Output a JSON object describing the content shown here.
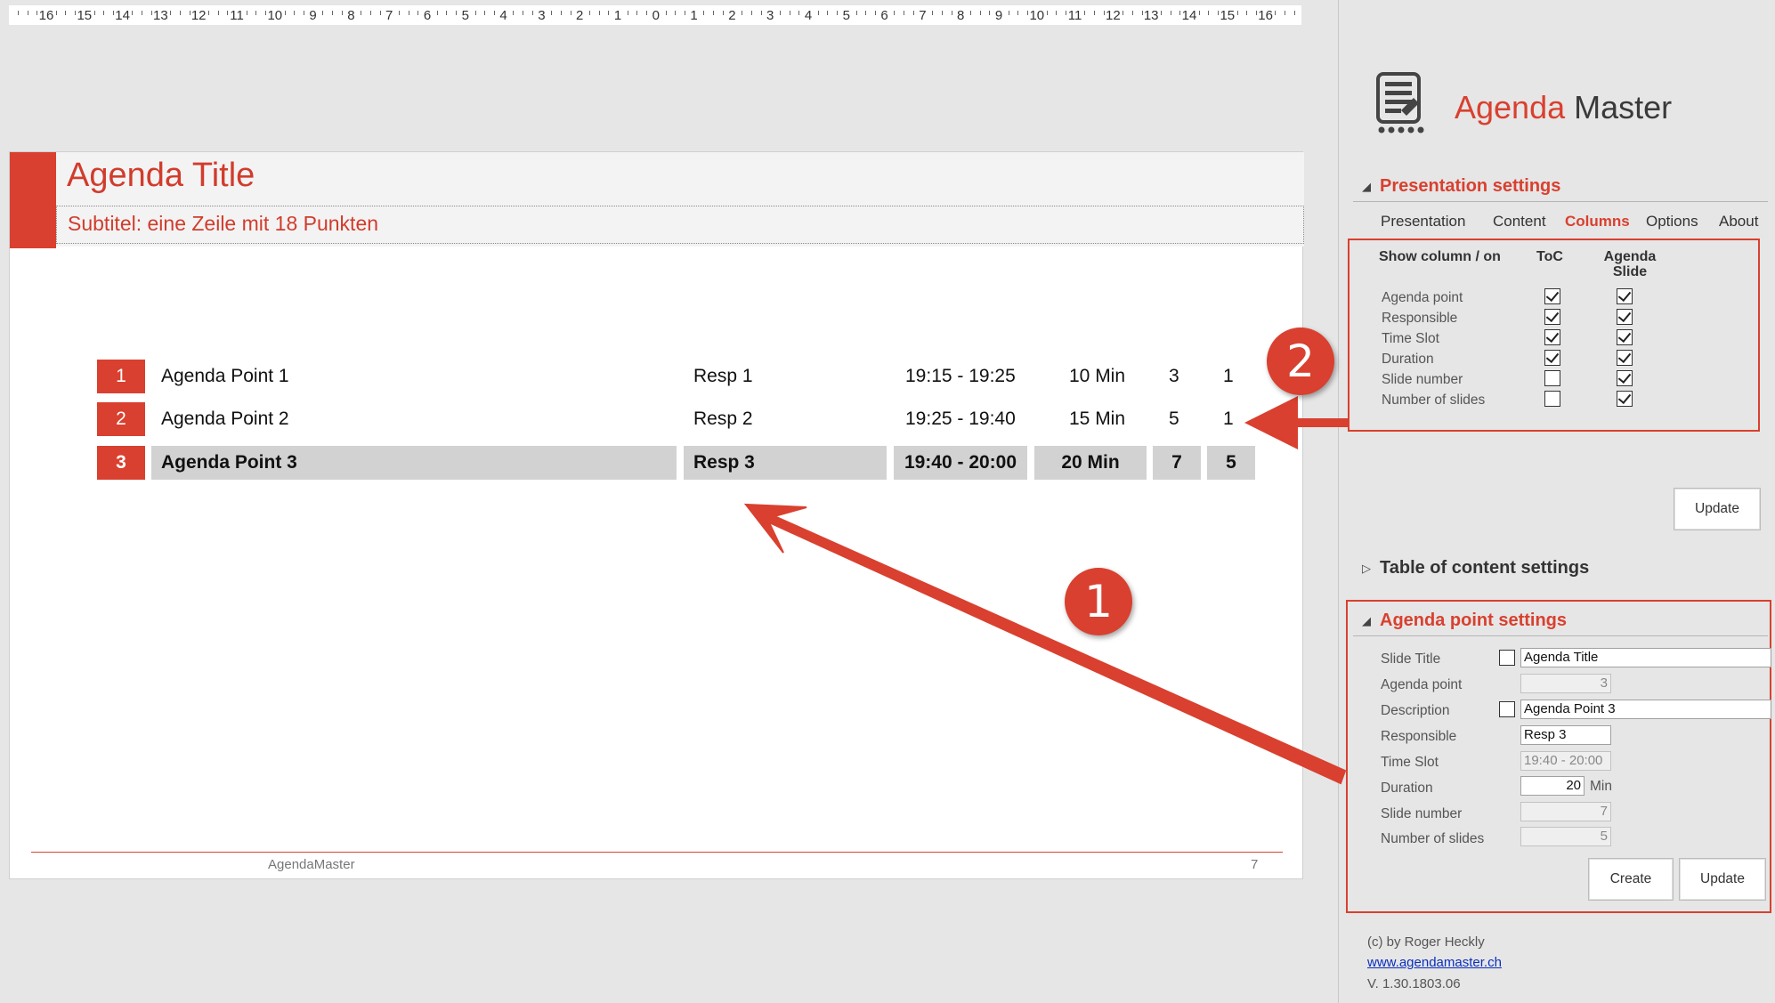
{
  "ruler": {
    "numbers": [
      "16",
      "15",
      "14",
      "13",
      "12",
      "11",
      "10",
      "9",
      "8",
      "7",
      "6",
      "5",
      "4",
      "3",
      "2",
      "1",
      "0",
      "1",
      "2",
      "3",
      "4",
      "5",
      "6",
      "7",
      "8",
      "9",
      "10",
      "11",
      "12",
      "13",
      "14",
      "15",
      "16"
    ]
  },
  "slide": {
    "title": "Agenda Title",
    "subtitle": "Subtitel: eine Zeile mit 18 Punkten",
    "rows": [
      {
        "num": "1",
        "point": "Agenda Point 1",
        "resp": "Resp 1",
        "time": "19:15 - 19:25",
        "duration": "10 Min",
        "slide": "3",
        "count": "1"
      },
      {
        "num": "2",
        "point": "Agenda Point 2",
        "resp": "Resp 2",
        "time": "19:25 - 19:40",
        "duration": "15 Min",
        "slide": "5",
        "count": "1"
      },
      {
        "num": "3",
        "point": "Agenda Point 3",
        "resp": "Resp 3",
        "time": "19:40 - 20:00",
        "duration": "20 Min",
        "slide": "7",
        "count": "5"
      }
    ],
    "footer_text": "AgendaMaster",
    "footer_page": "7"
  },
  "pane": {
    "brand_accent": "Agenda",
    "brand_rest": " Master",
    "presentation_settings": "Presentation settings",
    "tabs": [
      "Presentation",
      "Content",
      "Columns",
      "Options",
      "About"
    ],
    "columns": {
      "header_label": "Show column / on",
      "header_toc": "ToC",
      "header_agenda_1": "Agenda",
      "header_agenda_2": "Slide",
      "items": [
        "Agenda point",
        "Responsible",
        "Time Slot",
        "Duration",
        "Slide number",
        "Number of slides"
      ]
    },
    "update_label": "Update",
    "toc_settings": "Table of content settings",
    "agenda_point_settings": "Agenda point settings",
    "fields": {
      "slide_title_label": "Slide Title",
      "slide_title_value": "Agenda Title",
      "agenda_point_label": "Agenda point",
      "agenda_point_value": "3",
      "description_label": "Description",
      "description_value": "Agenda Point 3",
      "responsible_label": "Responsible",
      "responsible_value": "Resp 3",
      "time_slot_label": "Time Slot",
      "time_slot_value": "19:40 - 20:00",
      "duration_label": "Duration",
      "duration_value": "20",
      "duration_unit": "Min",
      "slide_number_label": "Slide number",
      "slide_number_value": "7",
      "num_slides_label": "Number of slides",
      "num_slides_value": "5"
    },
    "create_label": "Create",
    "update2_label": "Update",
    "copyright": "(c) by Roger Heckly",
    "website": "www.agendamaster.ch",
    "version": "V. 1.30.1803.06"
  },
  "annotations": {
    "badge1": "1",
    "badge2": "2"
  },
  "colors": {
    "accent": "#d9402f",
    "selected_row": "#d2d2d2"
  }
}
